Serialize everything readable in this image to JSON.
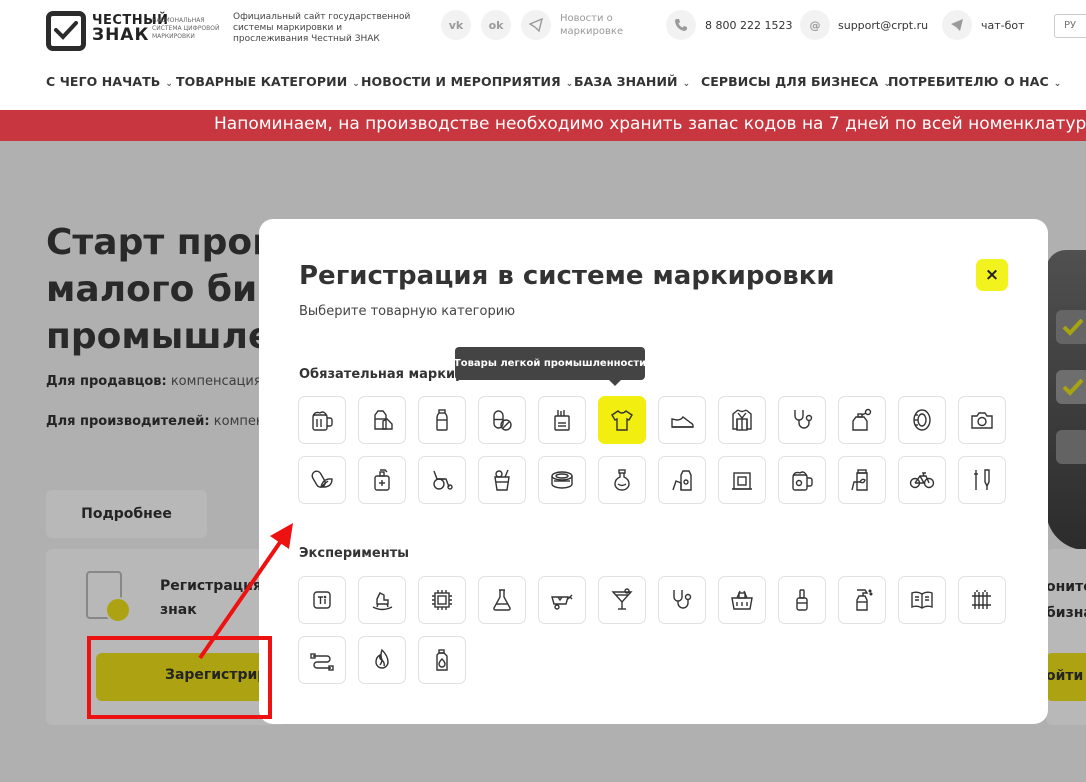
{
  "header": {
    "logo_line1": "ЧЕСТНЫЙ",
    "logo_line2": "ЗНАК",
    "logo_tagline": "НАЦИОНАЛЬНАЯ СИСТЕМА ЦИФРОВОЙ МАРКИРОВКИ",
    "official_text": "Официальный сайт государственной системы маркировки и прослеживания Честный ЗНАК",
    "social_vk": "vk",
    "social_ok": "ok",
    "news_link": "Новости о маркировке",
    "phone": "8 800 222 1523",
    "email": "support@crpt.ru",
    "chat_bot": "чат-бот",
    "language": "РУ"
  },
  "nav": {
    "items": [
      {
        "label": "С ЧЕГО НАЧАТЬ",
        "has_dropdown": true
      },
      {
        "label": "ТОВАРНЫЕ КАТЕГОРИИ",
        "has_dropdown": true
      },
      {
        "label": "НОВОСТИ И МЕРОПРИЯТИЯ",
        "has_dropdown": true
      },
      {
        "label": "БАЗА ЗНАНИЙ",
        "has_dropdown": true
      },
      {
        "label": "СЕРВИСЫ ДЛЯ БИЗНЕСА",
        "has_dropdown": true
      },
      {
        "label": "ПОТРЕБИТЕЛЮ",
        "has_dropdown": false
      },
      {
        "label": "О НАС",
        "has_dropdown": true
      }
    ]
  },
  "banner": {
    "text": "Напоминаем, на производстве необходимо хранить запас кодов на 7 дней по всей номенклатуре."
  },
  "page": {
    "hero_title_lines": [
      "Старт прогр",
      "малого бизн",
      "промышлен"
    ],
    "sellers_label": "Для продавцов:",
    "sellers_text": "компенсация",
    "producers_label": "Для производителей:",
    "producers_text": "компен",
    "more_button": "Подробнее",
    "card_title_line1": "Регистрация в",
    "card_title_line2": "знак",
    "register_button": "Зарегистриро",
    "right_card_line1": "онито",
    "right_card_line2": "бизнак",
    "right_button": "ойти"
  },
  "modal": {
    "title": "Регистрация в системе маркировки",
    "subtitle": "Выберите товарную категорию",
    "close_icon": "×",
    "section_mandatory": "Обязательная маркировка",
    "section_experiments": "Эксперименты",
    "tooltip": "Товары легкой промышленности",
    "mandatory_icons": [
      "beer-icon",
      "dairy-icon",
      "water-bottle-icon",
      "medicine-icon",
      "tobacco-icon",
      "clothing-icon",
      "shoes-icon",
      "fur-coat-icon",
      "stethoscope-icon",
      "perfume-icon",
      "tire-icon",
      "camera-icon",
      "bio-supplement-icon",
      "antiseptic-icon",
      "wheelchair-icon",
      "juice-icon",
      "canned-food-icon",
      "cosmetics-icon",
      "pet-food-icon",
      "radiator-icon",
      "kvass-icon",
      "vegetable-oil-icon",
      "bicycle-icon",
      "medical-device-icon"
    ],
    "experiment_icons": [
      "titanium-icon",
      "toy-horse-icon",
      "chip-icon",
      "flask-icon",
      "construction-icon",
      "cocktail-icon",
      "stethoscope-small-icon",
      "grocery-basket-icon",
      "nail-polish-icon",
      "spray-icon",
      "book-icon",
      "heating-radiator-icon",
      "cable-icon",
      "fire-icon",
      "motor-oil-icon"
    ],
    "active_icon": "clothing-icon"
  },
  "colors": {
    "brand_yellow": "#f2ee0f",
    "banner_red": "#c8373f",
    "annotation_red": "#ee1111"
  }
}
